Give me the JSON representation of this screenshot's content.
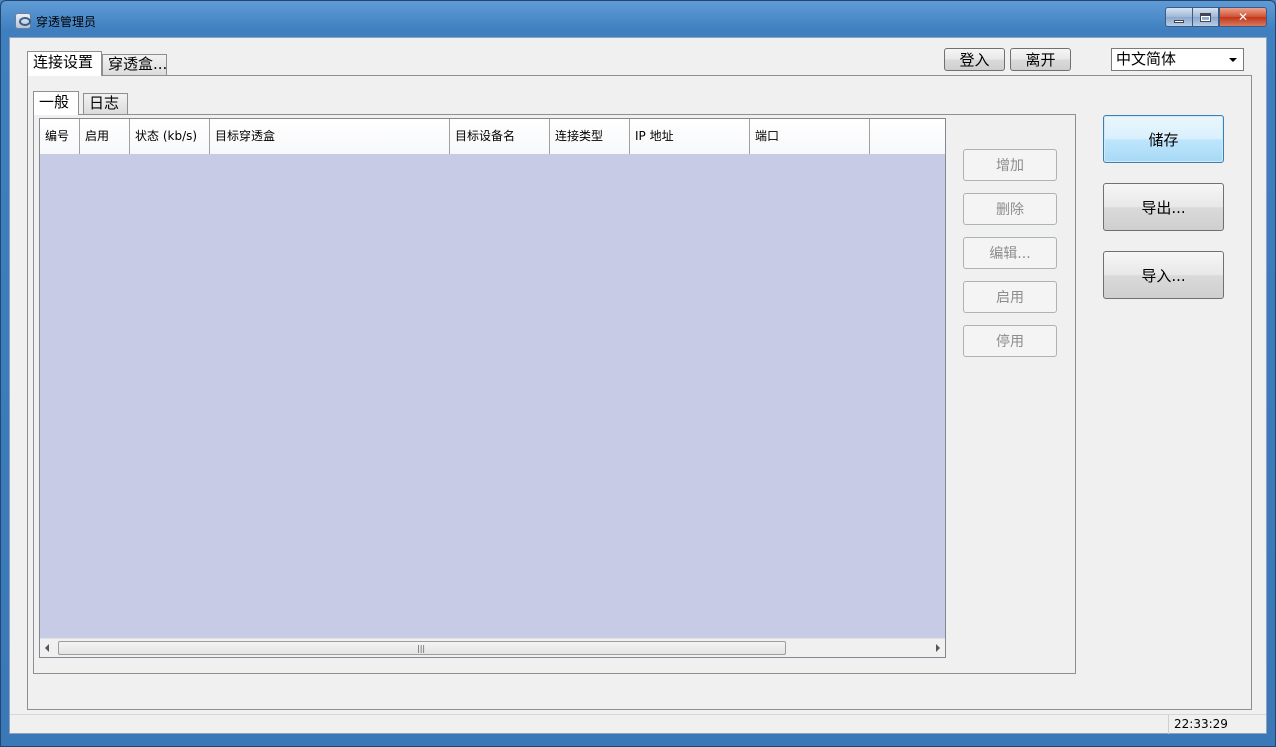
{
  "window": {
    "title": "穿透管理员"
  },
  "outer_tabs": [
    {
      "label": "连接设置",
      "active": true
    },
    {
      "label": "穿透盒...",
      "active": false
    }
  ],
  "top_buttons": {
    "login": "登入",
    "leave": "离开"
  },
  "language": {
    "selected": "中文简体"
  },
  "inner_tabs": [
    {
      "label": "一般",
      "active": true
    },
    {
      "label": "日志",
      "active": false
    }
  ],
  "table": {
    "columns": [
      "编号",
      "启用",
      "状态 (kb/s)",
      "目标穿透盒",
      "目标设备名",
      "连接类型",
      "IP 地址",
      "端口"
    ],
    "rows": []
  },
  "side_buttons": {
    "add": "增加",
    "delete": "删除",
    "edit": "编辑...",
    "enable": "启用",
    "disable": "停用"
  },
  "right_buttons": {
    "save": "储存",
    "export": "导出...",
    "import": "导入..."
  },
  "status": {
    "time": "22:33:29"
  },
  "colors": {
    "grid_background": "#c8cbe5",
    "title_gradient": "#3f7fbf"
  }
}
